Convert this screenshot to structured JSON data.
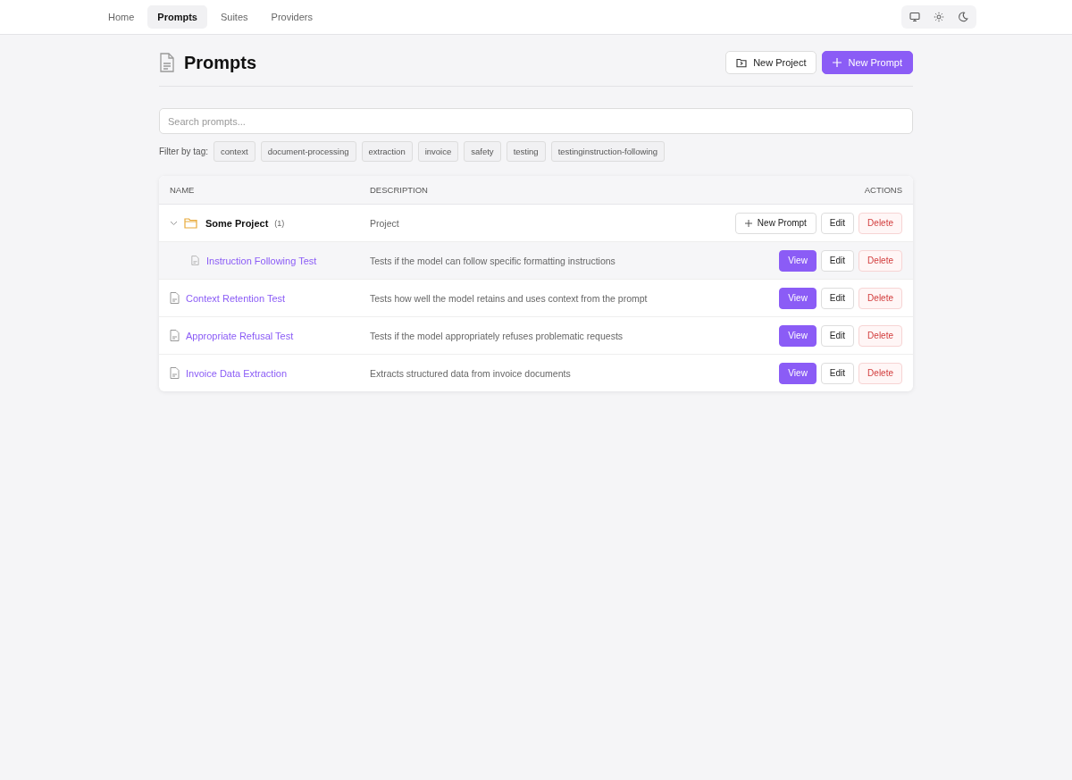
{
  "nav": {
    "tabs": [
      {
        "label": "Home",
        "selected": false
      },
      {
        "label": "Prompts",
        "selected": true
      },
      {
        "label": "Suites",
        "selected": false
      },
      {
        "label": "Providers",
        "selected": false
      }
    ]
  },
  "page": {
    "title": "Prompts",
    "buttons": [
      {
        "kind": "secondary",
        "label": "New Project"
      },
      {
        "kind": "primary",
        "label": "New Prompt"
      }
    ]
  },
  "search": {
    "placeholder": "Search prompts..."
  },
  "filter": {
    "label": "Filter by tag:",
    "tags": [
      "context",
      "document-processing",
      "extraction",
      "invoice",
      "safety",
      "testing",
      "testinginstruction-following"
    ]
  },
  "table": {
    "columns": [
      "NAME",
      "DESCRIPTION",
      "ACTIONS"
    ],
    "rows": [
      {
        "kind": "project",
        "name": "Some Project",
        "count": "(1)",
        "description": "Project",
        "expanded": true,
        "actions": [
          "New Prompt",
          "Edit",
          "Delete"
        ],
        "children": [
          {
            "name": "Instruction Following Test",
            "description": "Tests if the model can follow specific formatting instructions",
            "actions": [
              "View",
              "Edit",
              "Delete"
            ]
          }
        ]
      },
      {
        "kind": "prompt",
        "name": "Context Retention Test",
        "description": "Tests how well the model retains and uses context from the prompt",
        "actions": [
          "View",
          "Edit",
          "Delete"
        ]
      },
      {
        "kind": "prompt",
        "name": "Appropriate Refusal Test",
        "description": "Tests if the model appropriately refuses problematic requests",
        "actions": [
          "View",
          "Edit",
          "Delete"
        ]
      },
      {
        "kind": "prompt",
        "name": "Invoice Data Extraction",
        "description": "Extracts structured data from invoice documents",
        "actions": [
          "View",
          "Edit",
          "Delete"
        ]
      }
    ]
  }
}
